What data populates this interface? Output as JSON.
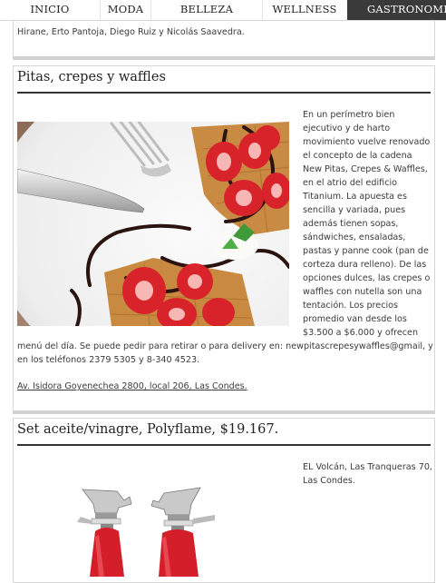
{
  "nav": {
    "items": [
      "INICIO",
      "MODA",
      "BELLEZA",
      "WELLNESS",
      "GASTRONOMIA"
    ],
    "active_index": 4
  },
  "card0": {
    "tail_text": "Hirane, Erto Pantoja, Diego Ruiz y Nicolás Saavedra."
  },
  "card1": {
    "title": "Pitas, crepes y waffles",
    "side_lines": [
      "En un perímetro bien",
      "ejecutivo y de harto",
      "movimiento vuelve renovado",
      "el concepto de la cadena",
      "New Pitas, Crepes & Waffles,",
      "en el atrio del edificio",
      "Titanium. La apuesta es",
      "sencilla y variada, pues",
      "además tienen sopas,",
      "sándwiches, ensaladas,",
      "pastas y panne cook (pan de",
      "corteza dura relleno). De las",
      "opciones dulces, las crepes o",
      "waffles con nutella son una",
      "tentación. Los precios",
      "promedio van desde los",
      "$3.500 a $6.000 y ofrecen"
    ],
    "full_lines": [
      "menú del día. Se puede pedir para retirar o para delivery en: newpitascrepesywaffles@gmail, y",
      "en  los teléfonos 2379 5305 y  8-340 4523."
    ],
    "address_link": "Av. Isidora Goyenechea 2800, local 206, Las Condes.",
    "image_alt": "waffles-strawberries-photo"
  },
  "card2": {
    "title": "Set aceite/vinagre, Polyflame, $19.167.",
    "side_lines": [
      "EL Volcán, Las Tranqueras 70,",
      "Las Condes."
    ],
    "image_alt": "oil-vinegar-set-photo"
  }
}
